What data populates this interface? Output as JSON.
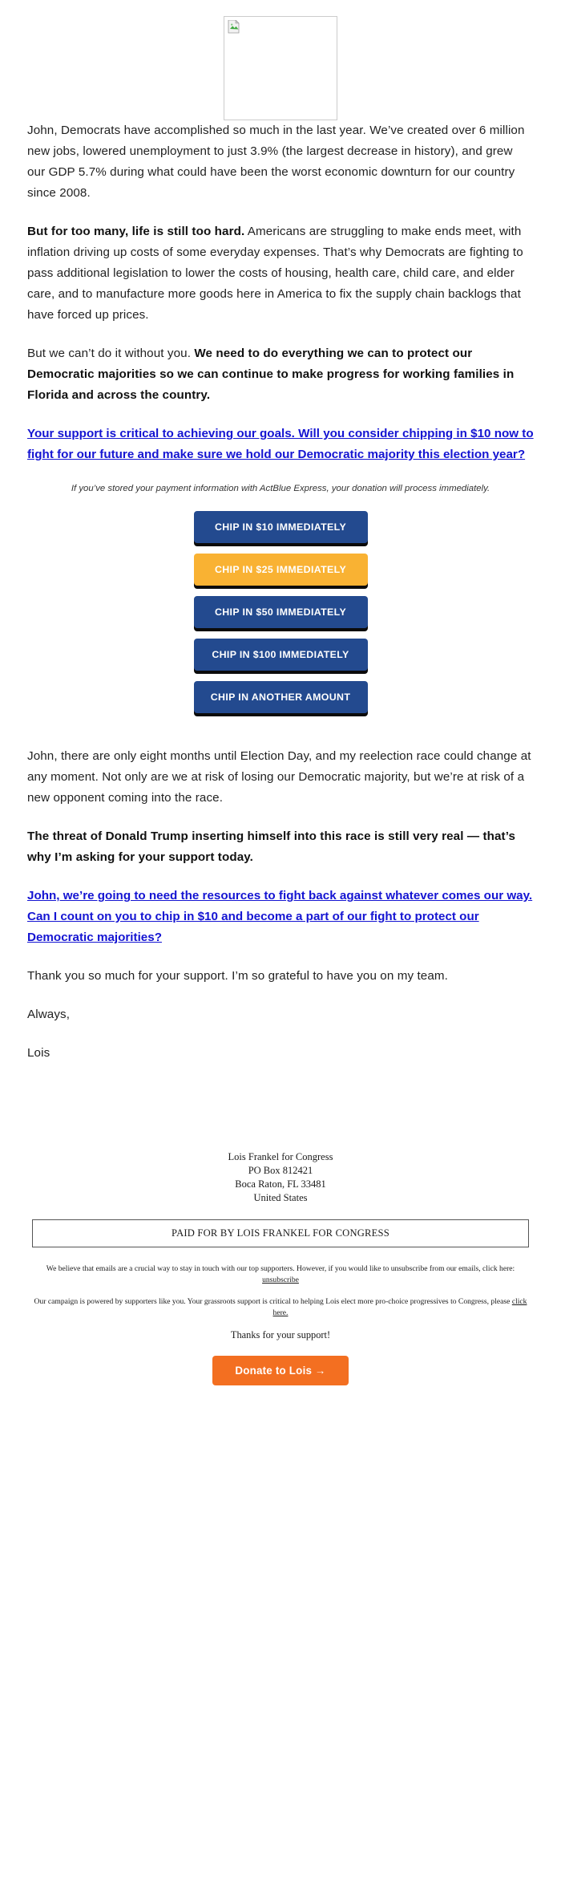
{
  "hero": {
    "image_alt": "",
    "icon": "broken-image-placeholder"
  },
  "body": {
    "p1_text": "John, Democrats have accomplished so much in the last year. We’ve created over 6 million new jobs, lowered unemployment to just 3.9% (the largest decrease in history), and grew our GDP 5.7% during what could have been the worst economic downturn for our country since 2008.",
    "p2_bold": "But for too many, life is still too hard.",
    "p2_rest": " Americans are struggling to make ends meet, with inflation driving up costs of some everyday expenses. That’s why Democrats are fighting to pass additional legislation to lower the costs of housing, health care, child care, and elder care, and to manufacture more goods here in America to fix the supply chain backlogs that have forced up prices.",
    "p3_lead": "But we can’t do it without you. ",
    "p3_bold": "We need to do everything we can to protect our Democratic majorities so we can continue to make progress for working families in Florida and across the country.",
    "link1_text": "Your support is critical to achieving our goals. Will you consider chipping in $10 now to fight for our future and make sure we hold our Democratic majority this election year?",
    "disclaimer": "If you’ve stored your payment information with ActBlue Express, your donation will process immediately.",
    "p4_text": "John, there are only eight months until Election Day, and my reelection race could change at any moment. Not only are we at risk of losing our Democratic majority, but we’re at risk of a new opponent coming into the race.",
    "p5_bold": "The threat of Donald Trump inserting himself into this race is still very real — that’s why I’m asking for your support today.",
    "link2_text": "John, we’re going to need the resources to fight back against whatever comes our way. Can I count on you to chip in $10 and become a part of our fight to protect our Democratic majorities?",
    "p6_text": "Thank you so much for your support. I’m so grateful to have you on my team.",
    "signoff_closing": "Always,",
    "signoff_name": "Lois"
  },
  "donate_buttons": [
    {
      "label": "CHIP IN $10 IMMEDIATELY",
      "style": "navy",
      "color": "#234a8f"
    },
    {
      "label": "CHIP IN $25 IMMEDIATELY",
      "style": "gold",
      "color": "#f9b233"
    },
    {
      "label": "CHIP IN $50 IMMEDIATELY",
      "style": "navy",
      "color": "#234a8f"
    },
    {
      "label": "CHIP IN $100 IMMEDIATELY",
      "style": "navy",
      "color": "#234a8f"
    },
    {
      "label": "CHIP IN ANOTHER AMOUNT",
      "style": "navy",
      "color": "#234a8f"
    }
  ],
  "footer": {
    "org": "Lois Frankel for Congress",
    "po_box": "PO Box 812421",
    "city_state_zip": "Boca Raton, FL 33481",
    "country": "United States",
    "paid_for": "PAID FOR BY LOIS FRANKEL FOR CONGRESS",
    "unsub_text": "We believe that emails are a crucial way to stay in touch with our top supporters. However, if you would like to unsubscribe from our emails, click here: ",
    "unsub_link": "unsubscribe",
    "grassroots_text": "Our campaign is powered by supporters like you. Your grassroots support is critical to helping Lois elect more pro-choice progressives to Congress, please ",
    "grassroots_link": "click here.",
    "thanks": "Thanks for your support!",
    "donate_label": "Donate to Lois →"
  },
  "colors": {
    "navy": "#234a8f",
    "gold": "#f9b233",
    "orange": "#f36f21",
    "link_blue": "#1414d2",
    "text": "#222222"
  }
}
